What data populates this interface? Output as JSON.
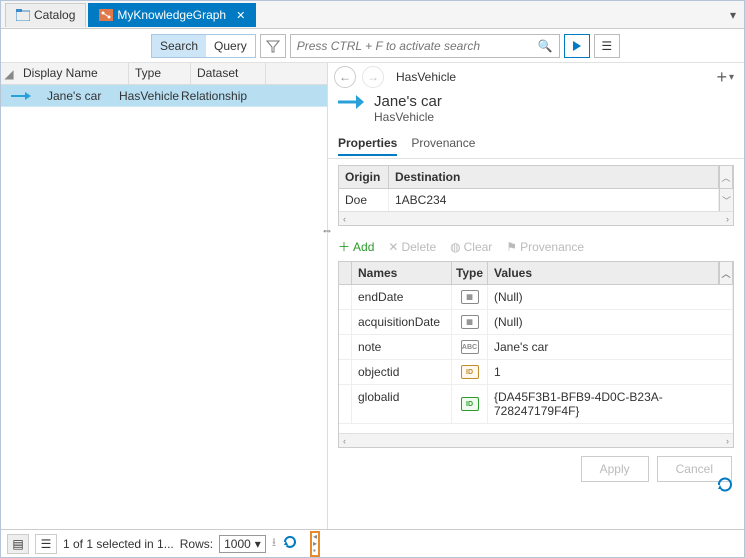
{
  "tabs": {
    "catalog": "Catalog",
    "kg": "MyKnowledgeGraph"
  },
  "search": {
    "searchLabel": "Search",
    "queryLabel": "Query",
    "placeholder": "Press CTRL + F to activate search"
  },
  "left_table": {
    "headers": {
      "c1": "Display Name",
      "c2": "Type",
      "c3": "Dataset"
    },
    "row": {
      "name": "Jane's car",
      "type": "HasVehicle",
      "dataset": "Relationship"
    }
  },
  "right": {
    "breadcrumb": "HasVehicle",
    "title": "Jane's car",
    "subtitle": "HasVehicle",
    "tabs": {
      "props": "Properties",
      "prov": "Provenance"
    },
    "origin": {
      "h1": "Origin",
      "h2": "Destination",
      "v1": "Doe",
      "v2": "1ABC234"
    },
    "toolbar": {
      "add": "Add",
      "delete": "Delete",
      "clear": "Clear",
      "prov": "Provenance"
    },
    "prop_headers": {
      "c1": "Names",
      "c2": "Type",
      "c3": "Values"
    },
    "props": {
      "p1": {
        "name": "endDate",
        "value": "(Null)"
      },
      "p2": {
        "name": "acquisitionDate",
        "value": "(Null)"
      },
      "p3": {
        "name": "note",
        "value": "Jane's car"
      },
      "p4": {
        "name": "objectid",
        "value": "1"
      },
      "p5": {
        "name": "globalid",
        "value": "{DA45F3B1-BFB9-4D0C-B23A-728247179F4F}"
      }
    },
    "buttons": {
      "apply": "Apply",
      "cancel": "Cancel"
    }
  },
  "status": {
    "text": "1 of 1 selected in 1...",
    "rowsLabel": "Rows:",
    "rowsValue": "1000"
  }
}
